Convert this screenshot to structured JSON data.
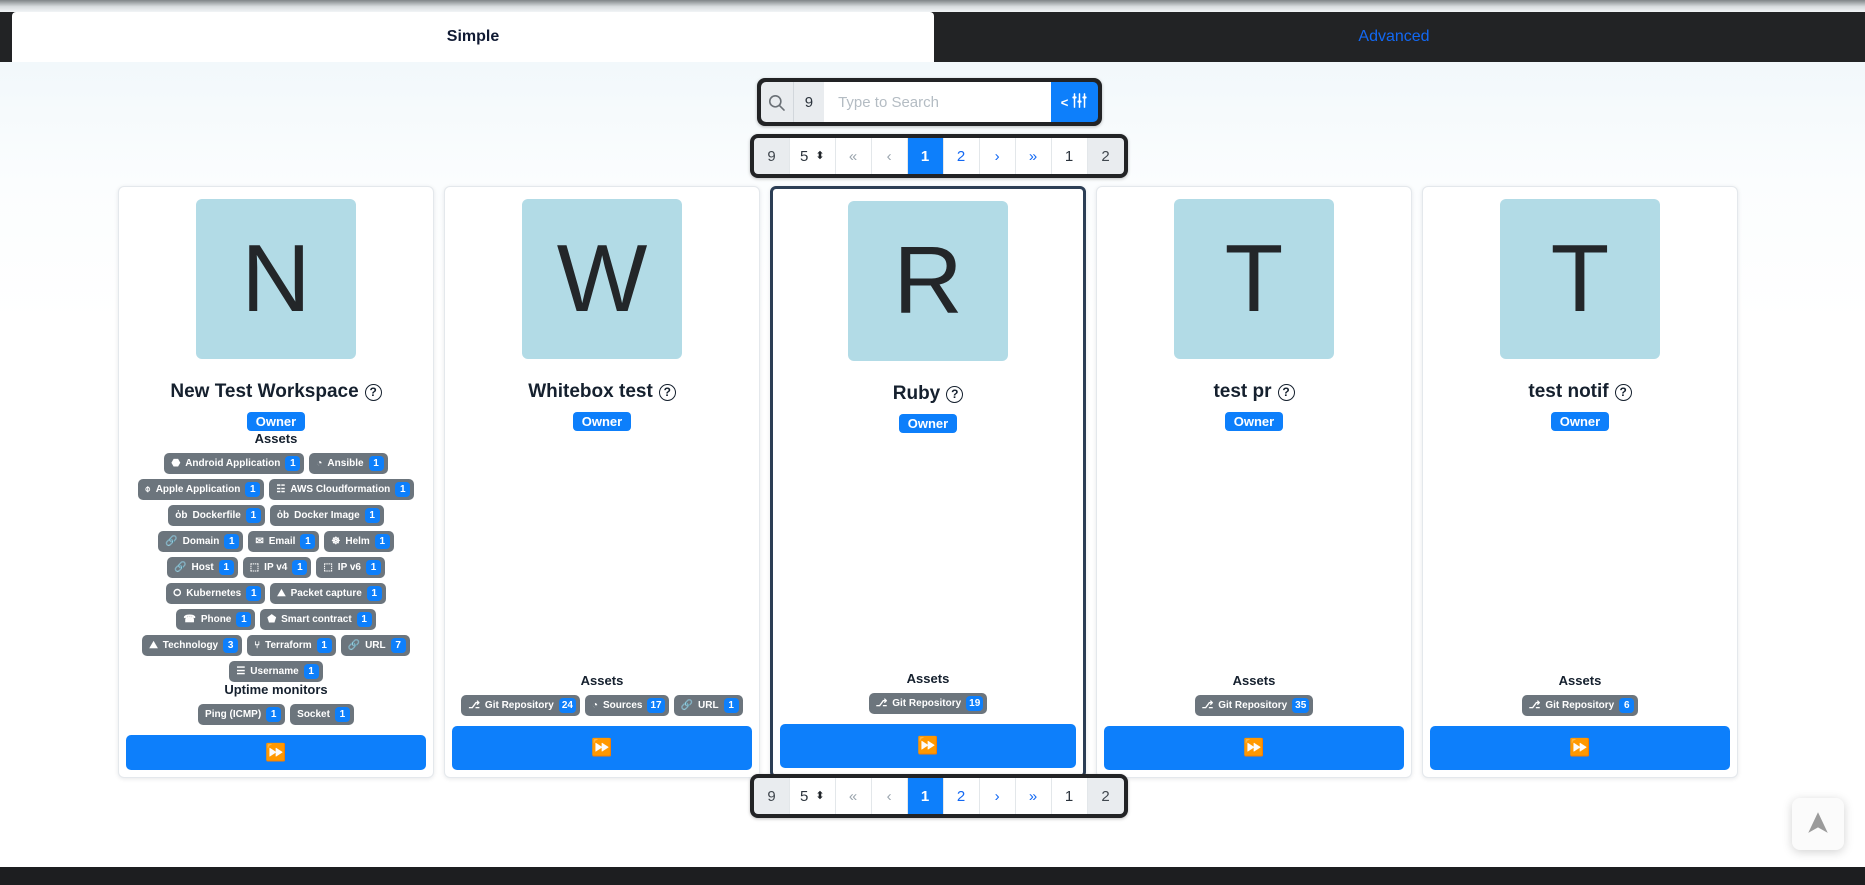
{
  "tabs": [
    {
      "label": "Simple",
      "active": true
    },
    {
      "label": "Advanced",
      "active": false
    }
  ],
  "search": {
    "icon": "search-icon",
    "result_count": "9",
    "placeholder": "Type to Search",
    "value": "",
    "filter_label": "< ⦙⦙⦙",
    "filter_icon": "sliders-icon"
  },
  "pagination": {
    "total": "9",
    "page_size": "5",
    "first_label": "«",
    "prev_label": "‹",
    "pages": [
      "1",
      "2"
    ],
    "active_page": "1",
    "next_label": "›",
    "last_label": "»",
    "current_page": "1",
    "total_pages": "2"
  },
  "colors": {
    "accent": "#0d7ffb",
    "tag_bg": "#6c757d",
    "avatar_bg": "#b2dbe6",
    "dark_chrome": "#222325",
    "selected_border": "#2c3e55"
  },
  "labels": {
    "assets": "Assets",
    "uptime_monitors": "Uptime monitors",
    "role_owner": "Owner",
    "help": "?",
    "open_action": "⏩"
  },
  "cards": [
    {
      "initial": "N",
      "name": "New Test Workspace",
      "role": "Owner",
      "selected": false,
      "assets": [
        {
          "icon": "android-icon",
          "glyph": "⬣",
          "label": "Android Application",
          "count": "1"
        },
        {
          "icon": "ansible-icon",
          "glyph": "◔",
          "label": "Ansible",
          "count": "1"
        },
        {
          "icon": "apple-icon",
          "glyph": "⌽",
          "label": "Apple Application",
          "count": "1"
        },
        {
          "icon": "aws-icon",
          "glyph": "☷",
          "label": "AWS Cloudformation",
          "count": "1"
        },
        {
          "icon": "docker-icon",
          "glyph": "ὀb",
          "label": "Dockerfile",
          "count": "1"
        },
        {
          "icon": "docker-image-icon",
          "glyph": "ὀb",
          "label": "Docker Image",
          "count": "1"
        },
        {
          "icon": "link-icon",
          "glyph": "🔗",
          "label": "Domain",
          "count": "1"
        },
        {
          "icon": "envelope-icon",
          "glyph": "✉",
          "label": "Email",
          "count": "1"
        },
        {
          "icon": "helm-icon",
          "glyph": "☸",
          "label": "Helm",
          "count": "1"
        },
        {
          "icon": "link-icon",
          "glyph": "🔗",
          "label": "Host",
          "count": "1"
        },
        {
          "icon": "server-icon",
          "glyph": "⬚",
          "label": "IP v4",
          "count": "1"
        },
        {
          "icon": "server-icon",
          "glyph": "⬚",
          "label": "IP v6",
          "count": "1"
        },
        {
          "icon": "kubernetes-icon",
          "glyph": "⭘",
          "label": "Kubernetes",
          "count": "1"
        },
        {
          "icon": "packet-capture-icon",
          "glyph": "⛰",
          "label": "Packet capture",
          "count": "1"
        },
        {
          "icon": "phone-icon",
          "glyph": "☎",
          "label": "Phone",
          "count": "1"
        },
        {
          "icon": "contract-icon",
          "glyph": "⬟",
          "label": "Smart contract",
          "count": "1"
        },
        {
          "icon": "technology-icon",
          "glyph": "⛰",
          "label": "Technology",
          "count": "3"
        },
        {
          "icon": "terraform-icon",
          "glyph": "⑂",
          "label": "Terraform",
          "count": "1"
        },
        {
          "icon": "link-icon",
          "glyph": "🔗",
          "label": "URL",
          "count": "7"
        },
        {
          "icon": "username-icon",
          "glyph": "☰",
          "label": "Username",
          "count": "1"
        }
      ],
      "uptime_monitors": [
        {
          "icon": "ping-icon",
          "glyph": "",
          "label": "Ping (ICMP)",
          "count": "1"
        },
        {
          "icon": "socket-icon",
          "glyph": "",
          "label": "Socket",
          "count": "1"
        }
      ]
    },
    {
      "initial": "W",
      "name": "Whitebox test",
      "role": "Owner",
      "selected": false,
      "assets": [
        {
          "icon": "git-icon",
          "glyph": "⎇",
          "label": "Git Repository",
          "count": "24"
        },
        {
          "icon": "sources-icon",
          "glyph": "◔",
          "label": "Sources",
          "count": "17"
        },
        {
          "icon": "link-icon",
          "glyph": "🔗",
          "label": "URL",
          "count": "1"
        }
      ],
      "uptime_monitors": []
    },
    {
      "initial": "R",
      "name": "Ruby",
      "role": "Owner",
      "selected": true,
      "assets": [
        {
          "icon": "git-icon",
          "glyph": "⎇",
          "label": "Git Repository",
          "count": "19"
        }
      ],
      "uptime_monitors": []
    },
    {
      "initial": "T",
      "name": "test pr",
      "role": "Owner",
      "selected": false,
      "assets": [
        {
          "icon": "git-icon",
          "glyph": "⎇",
          "label": "Git Repository",
          "count": "35"
        }
      ],
      "uptime_monitors": []
    },
    {
      "initial": "T",
      "name": "test notif",
      "role": "Owner",
      "selected": false,
      "assets": [
        {
          "icon": "git-icon",
          "glyph": "⎇",
          "label": "Git Repository",
          "count": "6"
        }
      ],
      "uptime_monitors": []
    }
  ],
  "scroll_to_top": {
    "icon": "arrow-up-icon"
  }
}
